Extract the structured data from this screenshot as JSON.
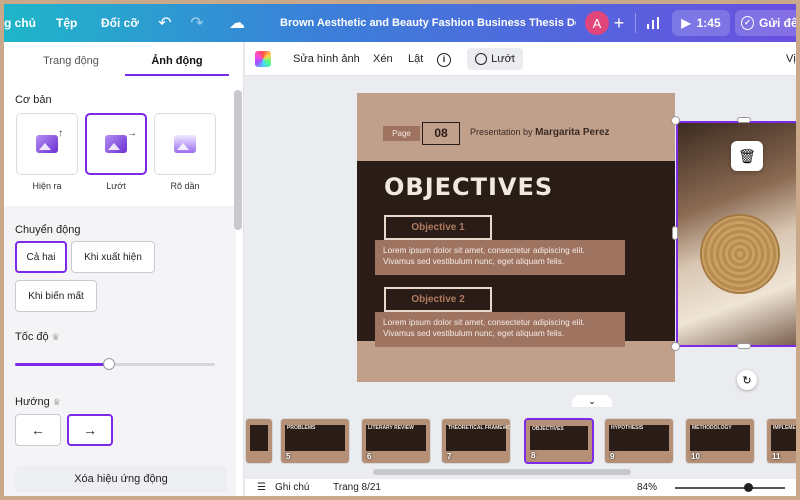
{
  "topbar": {
    "menu_home": "g chủ",
    "menu_file": "Tệp",
    "menu_resize": "Đổi cỡ",
    "doc_title": "Brown Aesthetic and Beauty Fashion Business Thesis Defen...",
    "avatar_letter": "A",
    "play_time": "1:45",
    "send_label": "Gửi đến"
  },
  "panel": {
    "tabs": [
      "Trang động",
      "Ảnh động"
    ],
    "basic_title": "Cơ bản",
    "basic_items": [
      "Hiện ra",
      "Lướt",
      "Rõ dần"
    ],
    "motion_title": "Chuyển động",
    "motion_options": [
      "Cả hai",
      "Khi xuất hiện",
      "Khi biến mất"
    ],
    "speed_title": "Tốc độ",
    "speed_value": 0.47,
    "direction_title": "Hướng",
    "remove_label": "Xóa hiệu ứng động"
  },
  "toolbar": {
    "edit_image": "Sửa hình ảnh",
    "crop": "Xén",
    "flip": "Lật",
    "slide_label": "Lướt",
    "more": "Vị"
  },
  "slide": {
    "page_label": "Page",
    "page_number": "08",
    "presented_by": "Presentation by",
    "presenter": "Margarita Perez",
    "title": "OBJECTIVES",
    "objectives": [
      {
        "label": "Objective 1",
        "text": "Lorem ipsum dolor sit amet, consectetur adipiscing elit. Vivamus sed vestibulum nunc, eget aliquam felis."
      },
      {
        "label": "Objective 2",
        "text": "Lorem ipsum dolor sit amet, consectetur adipiscing elit. Vivamus sed vestibulum nunc, eget aliquam felis."
      }
    ]
  },
  "filmstrip": {
    "thumbs": [
      {
        "num": "",
        "title": ""
      },
      {
        "num": "5",
        "title": "PROBLEMS"
      },
      {
        "num": "6",
        "title": "LITERARY REVIEW"
      },
      {
        "num": "7",
        "title": "THEORETICAL FRAMEWORK"
      },
      {
        "num": "8",
        "title": "OBJECTIVES"
      },
      {
        "num": "9",
        "title": "HYPOTHESIS"
      },
      {
        "num": "10",
        "title": "METHODOLOGY"
      },
      {
        "num": "11",
        "title": "IMPLEMENT"
      }
    ]
  },
  "status": {
    "notes": "Ghi chú",
    "page": "Trang 8/21",
    "zoom": "84%"
  },
  "colors": {
    "accent": "#7d2ae8",
    "slide_bg": "#c09f8b",
    "slide_dark": "#2a1d17",
    "slide_brown": "#9e7460"
  }
}
